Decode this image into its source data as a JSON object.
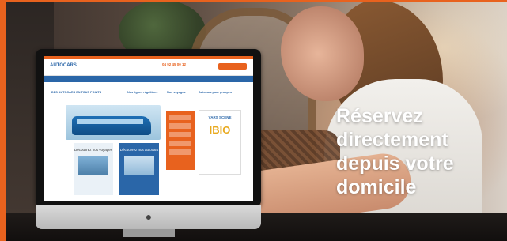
{
  "brand": {
    "accent_color": "#e8621e",
    "primary_color": "#2a66a8"
  },
  "headline": {
    "line1": "Réservez",
    "line2": "directement",
    "line3": "depuis votre",
    "line4": "domicile"
  },
  "website": {
    "logo_text": "AUTOCARS",
    "phone": "04 92 45 00 12",
    "tags": [
      "DES AUTOCARS EN TOUS POINTS",
      "Nos lignes régulières",
      "Nos voyages",
      "Autocars pour groupes"
    ],
    "poster_title": "VARS SCENE",
    "poster_big": "IBIO",
    "card_left_title": "Découvrez nos voyages",
    "card_right_title": "Découvrez nos autocars"
  },
  "icons": {
    "apple": "apple-logo-icon"
  }
}
